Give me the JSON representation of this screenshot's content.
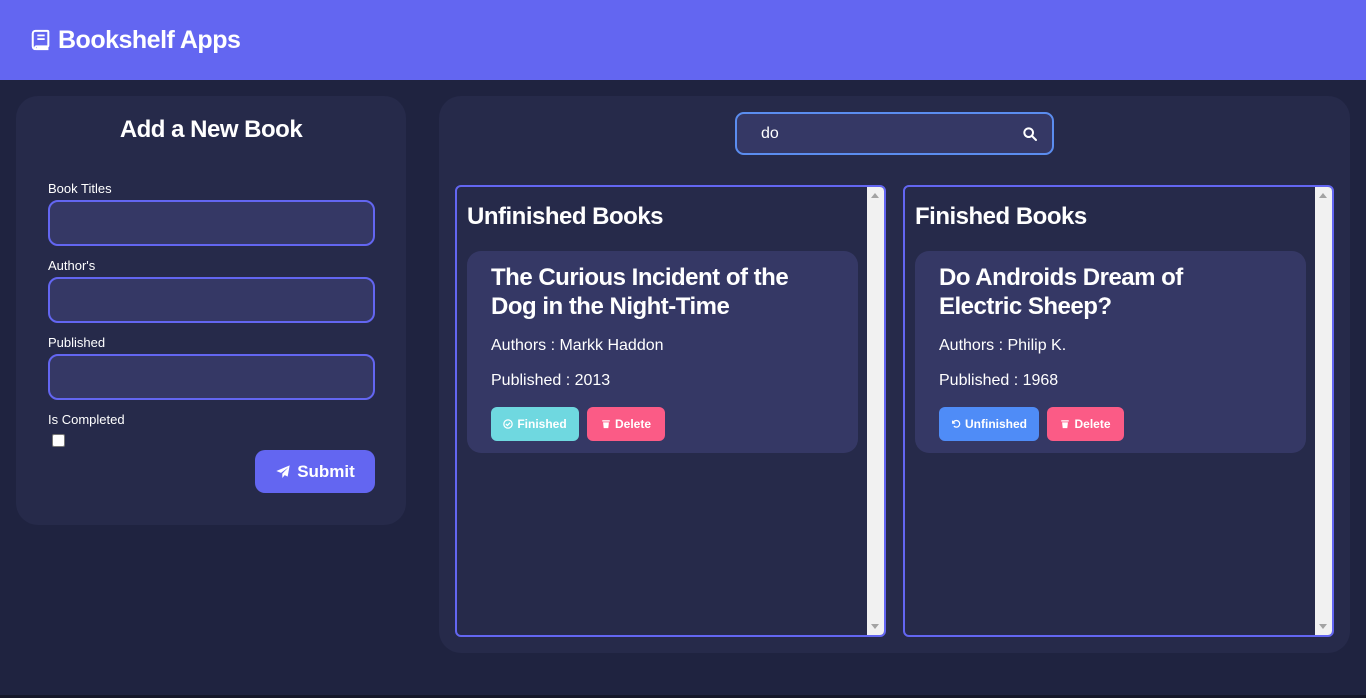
{
  "header": {
    "title": "Bookshelf Apps",
    "icon": "book-icon",
    "color": "#6366f1"
  },
  "form": {
    "title": "Add a New Book",
    "title_label": "Book Titles",
    "author_label": "Author's",
    "published_label": "Published",
    "completed_label": "Is Completed",
    "title_value": "",
    "author_value": "",
    "published_value": "",
    "is_completed": false,
    "submit_label": "Submit"
  },
  "search": {
    "value": "do",
    "icon": "search-icon"
  },
  "unfinished": {
    "heading": "Unfinished Books",
    "books": [
      {
        "title": "The Curious Incident of the Dog in the Night-Time",
        "authors": "Authors : Markk Haddon",
        "published": "Published : 2013",
        "toggle_label": "Finished",
        "delete_label": "Delete"
      }
    ]
  },
  "finished": {
    "heading": "Finished Books",
    "books": [
      {
        "title": "Do Androids Dream of Electric Sheep?",
        "authors": "Authors : Philip K.",
        "published": "Published : 1968",
        "toggle_label": "Unfinished",
        "delete_label": "Delete"
      }
    ]
  },
  "colors": {
    "finished_button": "#6fd8e0",
    "unfinished_button": "#4f8cf7",
    "delete_button": "#fb5b86"
  }
}
